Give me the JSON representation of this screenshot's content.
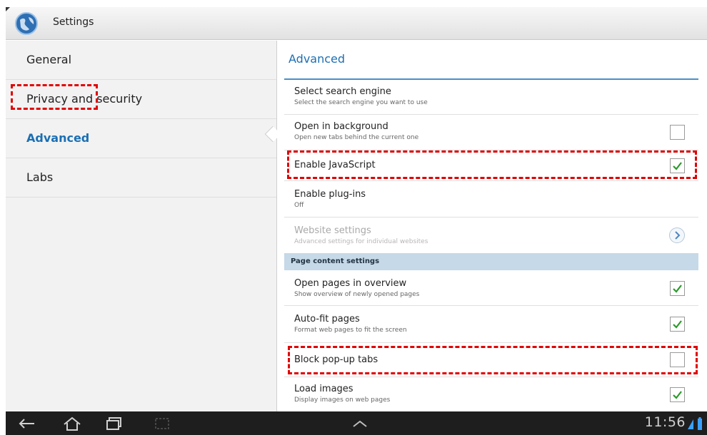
{
  "window": {
    "title": "Settings",
    "icon": "globe-icon"
  },
  "sidebar": {
    "items": [
      {
        "label": "General",
        "active": false
      },
      {
        "label": "Privacy and security",
        "active": false
      },
      {
        "label": "Advanced",
        "active": true
      },
      {
        "label": "Labs",
        "active": false
      }
    ]
  },
  "main": {
    "title": "Advanced",
    "rows": [
      {
        "title": "Select search engine",
        "subtitle": "Select the search engine you want to use",
        "control": "none"
      },
      {
        "title": "Open in background",
        "subtitle": "Open new tabs behind the current one",
        "control": "checkbox",
        "checked": false
      },
      {
        "title": "Enable JavaScript",
        "subtitle": "",
        "control": "checkbox",
        "checked": true
      },
      {
        "title": "Enable plug-ins",
        "subtitle": "Off",
        "control": "none"
      },
      {
        "title": "Website settings",
        "subtitle": "Advanced settings for individual websites",
        "control": "chevron",
        "disabled": true
      }
    ],
    "section_header": "Page content settings",
    "content_rows": [
      {
        "title": "Open pages in overview",
        "subtitle": "Show overview of newly opened pages",
        "control": "checkbox",
        "checked": true
      },
      {
        "title": "Auto-fit pages",
        "subtitle": "Format web pages to fit the screen",
        "control": "checkbox",
        "checked": true
      },
      {
        "title": "Block pop-up tabs",
        "subtitle": "",
        "control": "checkbox",
        "checked": false
      },
      {
        "title": "Load images",
        "subtitle": "Display images on web pages",
        "control": "checkbox",
        "checked": true
      }
    ]
  },
  "system_bar": {
    "time": "11:56",
    "icons": [
      "back-icon",
      "home-icon",
      "recent-apps-icon",
      "screenshot-icon",
      "chevron-up-icon",
      "signal-icon",
      "battery-icon"
    ]
  },
  "colors": {
    "accent": "#1b6fb3",
    "check": "#2a9a2a",
    "highlight": "#e00000",
    "section_bg": "#c5d9e8"
  }
}
